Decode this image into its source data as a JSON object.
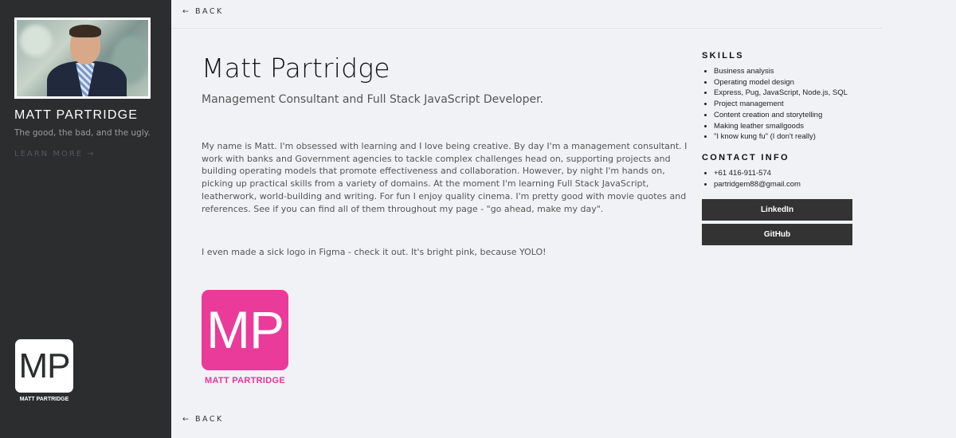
{
  "sidebar": {
    "name": "MATT PARTRIDGE",
    "tagline": "The good, the bad, and the ugly.",
    "learn_more": "LEARN MORE →",
    "logo_text": "MP",
    "logo_caption": "MATT PARTRIDGE"
  },
  "nav": {
    "back_top": "←  BACK",
    "back_bottom": "←  BACK"
  },
  "main": {
    "title": "Matt Partridge",
    "subtitle": "Management Consultant and Full Stack JavaScript Developer.",
    "bio": "My name is Matt. I'm obsessed with learning and I love being creative. By day I'm a management consultant. I work with banks and Government agencies to tackle complex challenges head on, supporting projects and building operating models that promote effectiveness and collaboration. However, by night I'm hands on, picking up practical skills from a variety of domains. At the moment I'm learning Full Stack JavaScript, leatherwork, world-building and writing. For fun I enjoy quality cinema. I'm pretty good with movie quotes and references. See if you can find all of them throughout my page - \"go ahead, make my day\".",
    "logo_line": "I even made a sick logo in Figma - check it out. It's bright pink, because YOLO!",
    "logo_text": "MP",
    "logo_caption": "MATT PARTRIDGE"
  },
  "skills": {
    "heading": "SKILLS",
    "items": [
      "Business analysis",
      "Operating model design",
      "Express, Pug, JavaScript, Node.js, SQL",
      "Project management",
      "Content creation and storytelling",
      "Making leather smallgoods",
      "\"I know kung fu\" (I don't really)"
    ]
  },
  "contact": {
    "heading": "CONTACT INFO",
    "items": [
      "+61 416-911-574",
      "partridgem88@gmail.com"
    ],
    "linkedin": "LinkedIn",
    "github": "GitHub"
  },
  "colors": {
    "sidebar_bg": "#2c2d2f",
    "page_bg": "#f1f2f5",
    "brand_pink": "#ea3b9b",
    "button_bg": "#333333"
  }
}
